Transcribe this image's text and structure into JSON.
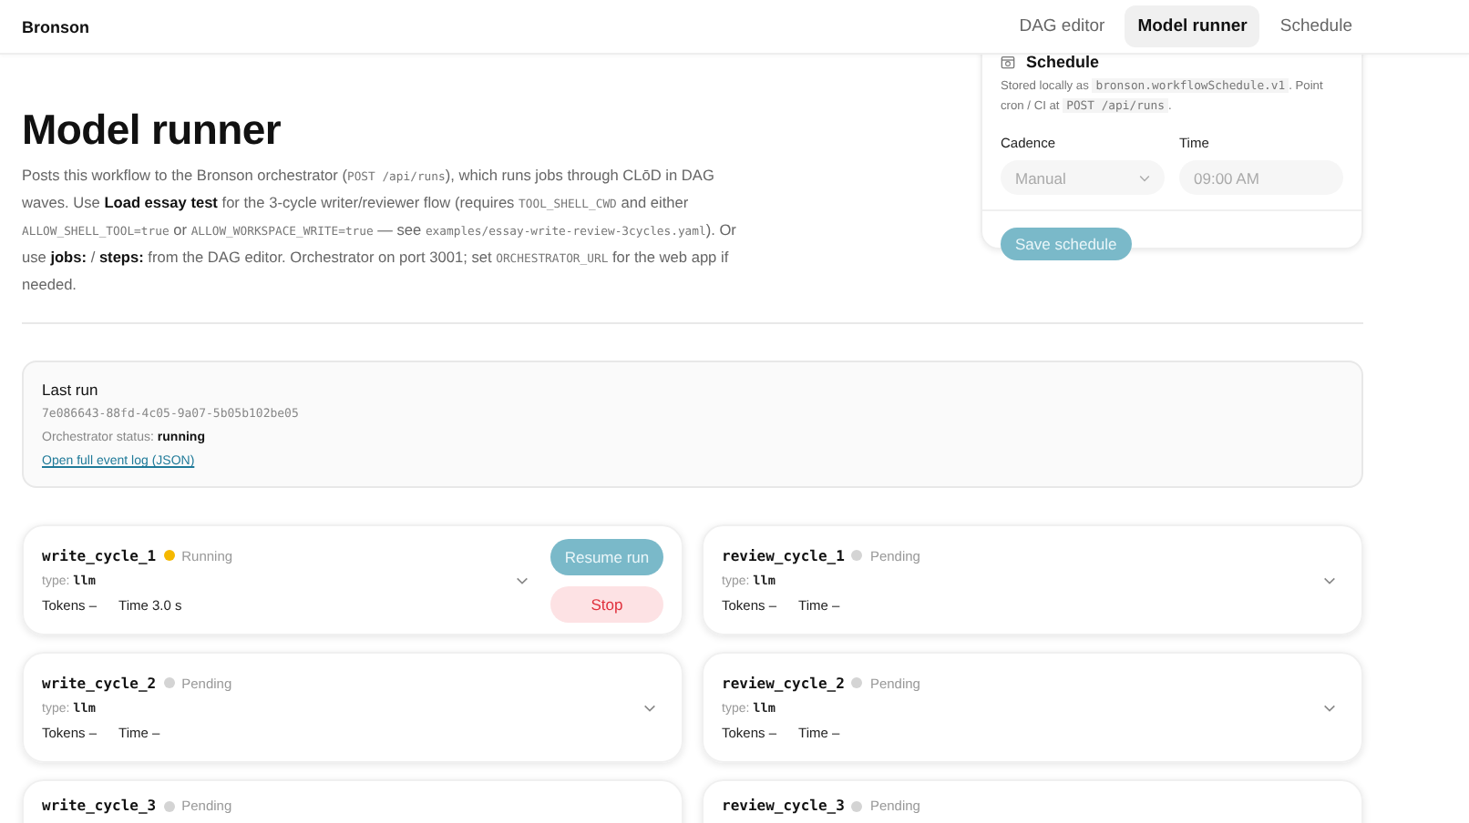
{
  "header": {
    "brand": "Bronson",
    "nav": [
      {
        "label": "DAG editor",
        "selected": false
      },
      {
        "label": "Model runner",
        "selected": true
      },
      {
        "label": "Schedule",
        "selected": false
      }
    ]
  },
  "page": {
    "title": "Model runner",
    "description": [
      {
        "kind": "text",
        "text": "Posts this workflow to the Bronson orchestrator ("
      },
      {
        "kind": "code",
        "text": "POST /api/runs"
      },
      {
        "kind": "text",
        "text": "), which runs jobs through CLōD in DAG waves. Use "
      },
      {
        "kind": "bold",
        "text": "Load essay test"
      },
      {
        "kind": "text",
        "text": " for the 3-cycle writer/reviewer flow (requires "
      },
      {
        "kind": "code",
        "text": "TOOL_SHELL_CWD"
      },
      {
        "kind": "text",
        "text": " and either "
      },
      {
        "kind": "code",
        "text": "ALLOW_SHELL_TOOL=true"
      },
      {
        "kind": "text",
        "text": " or "
      },
      {
        "kind": "code",
        "text": "ALLOW_WORKSPACE_WRITE=true"
      },
      {
        "kind": "text",
        "text": " — see "
      },
      {
        "kind": "code",
        "text": "examples/essay-write-review-3cycles.yaml"
      },
      {
        "kind": "text",
        "text": "). Or use "
      },
      {
        "kind": "bold",
        "text": "jobs:"
      },
      {
        "kind": "text",
        "text": " / "
      },
      {
        "kind": "bold",
        "text": "steps:"
      },
      {
        "kind": "text",
        "text": " from the DAG editor. Orchestrator on port 3001; set "
      },
      {
        "kind": "code",
        "text": "ORCHESTRATOR_URL"
      },
      {
        "kind": "text",
        "text": " for the web app if needed."
      }
    ]
  },
  "schedule": {
    "title": "Schedule",
    "note": [
      {
        "kind": "text",
        "text": "Stored locally as "
      },
      {
        "kind": "code",
        "text": "bronson.workflowSchedule.v1"
      },
      {
        "kind": "text",
        "text": ". Point cron / CI at "
      },
      {
        "kind": "code",
        "text": "POST /api/runs"
      },
      {
        "kind": "text",
        "text": "."
      }
    ],
    "cadence_label": "Cadence",
    "cadence_value": "Manual",
    "time_label": "Time",
    "time_value": "09:00 AM",
    "save_button": "Save schedule"
  },
  "last_run": {
    "title": "Last run",
    "run_id": "7e086643-88fd-4c05-9a07-5b05b102be05",
    "status_label": "Orchestrator status:",
    "status_value": "running",
    "link": "Open full event log (JSON)"
  },
  "jobs": [
    {
      "name": "write_cycle_1",
      "status": "Running",
      "color": "#f5b800",
      "type_label": "type:",
      "type": "llm",
      "tokens": "Tokens –",
      "time": "Time 3.0 s",
      "actions": [
        {
          "kind": "resume",
          "label": "Resume run"
        },
        {
          "kind": "stop",
          "label": "Stop"
        }
      ]
    },
    {
      "name": "review_cycle_1",
      "status": "Pending",
      "color": "#d4d4d4",
      "type_label": "type:",
      "type": "llm",
      "tokens": "Tokens –",
      "time": "Time –"
    },
    {
      "name": "write_cycle_2",
      "status": "Pending",
      "color": "#d4d4d4",
      "type_label": "type:",
      "type": "llm",
      "tokens": "Tokens –",
      "time": "Time –"
    },
    {
      "name": "review_cycle_2",
      "status": "Pending",
      "color": "#d4d4d4",
      "type_label": "type:",
      "type": "llm",
      "tokens": "Tokens –",
      "time": "Time –"
    },
    {
      "name": "write_cycle_3",
      "status": "Pending",
      "color": "#d4d4d4"
    },
    {
      "name": "review_cycle_3",
      "status": "Pending",
      "color": "#d4d4d4"
    }
  ]
}
